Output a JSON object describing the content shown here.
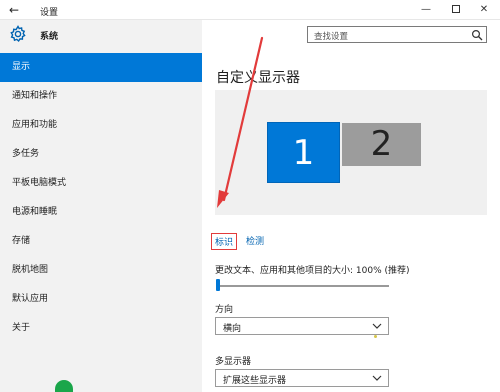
{
  "window": {
    "title": "设置",
    "back_label": "←",
    "min_label": "—",
    "close_label": "✕"
  },
  "sidebar": {
    "header": "系统",
    "items": [
      {
        "label": "显示",
        "active": true
      },
      {
        "label": "通知和操作",
        "active": false
      },
      {
        "label": "应用和功能",
        "active": false
      },
      {
        "label": "多任务",
        "active": false
      },
      {
        "label": "平板电脑模式",
        "active": false
      },
      {
        "label": "电源和睡眠",
        "active": false
      },
      {
        "label": "存储",
        "active": false
      },
      {
        "label": "脱机地图",
        "active": false
      },
      {
        "label": "默认应用",
        "active": false
      },
      {
        "label": "关于",
        "active": false
      }
    ]
  },
  "search": {
    "placeholder": "查找设置"
  },
  "main": {
    "title": "自定义显示器",
    "monitors": [
      {
        "number": "1",
        "selected": true
      },
      {
        "number": "2",
        "selected": false
      }
    ],
    "identify_label": "标识",
    "detect_label": "检测",
    "scale_label": "更改文本、应用和其他项目的大小: 100% (推荐)",
    "scale_value": 100,
    "orientation_label": "方向",
    "orientation_value": "横向",
    "multi_display_label": "多显示器",
    "multi_display_value": "扩展这些显示器"
  },
  "colors": {
    "accent": "#0078d7",
    "sidebar_bg": "#f2f2f2",
    "annotation": "#e23b3b",
    "monitor_inactive": "#9c9c9c"
  },
  "icons": {
    "header_icon": "gear-icon",
    "search_icon": "search-icon",
    "dropdown_icon": "chevron-down-icon"
  }
}
